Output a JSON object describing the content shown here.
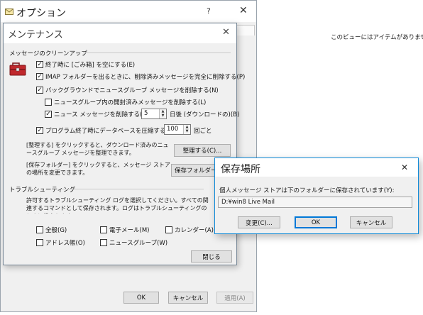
{
  "background": {
    "empty_message": "このビューにはアイテムがありません。"
  },
  "options": {
    "title": "オプション",
    "help": "?",
    "close": "✕",
    "ok_label": "OK",
    "cancel_label": "キャンセル",
    "apply_label": "適用(A)"
  },
  "maintenance": {
    "title": "メンテナンス",
    "close": "✕",
    "cleanup_group": "メッセージのクリーンアップ",
    "options": [
      {
        "label": "終了時に [ごみ箱] を空にする(E)",
        "checked": true
      },
      {
        "label": "IMAP フォルダーを出るときに、削除済みメッセージを完全に削除する(P)",
        "checked": true
      },
      {
        "label": "バックグラウンドでニュースグループ メッセージを削除する(N)",
        "checked": true
      },
      {
        "label": "ニュースグループ内の開封済みメッセージを削除する(L)",
        "checked": false
      },
      {
        "label": "ニュース メッセージを削除する(D)",
        "checked": true
      },
      {
        "label": "プログラム終了時にデータベースを圧縮する(S)",
        "checked": true
      }
    ],
    "news_days_value": "5",
    "news_days_suffix": "日後 (ダウンロードの)(B)",
    "compress_value": "100",
    "compress_suffix": "回ごと",
    "cleanup_desc": "[整理する] をクリックすると、ダウンロード済みのニュースグループ メッセージを整理できます。",
    "cleanup_button": "整理する(C)...",
    "store_desc": "[保存フォルダー] をクリックすると、メッセージ ストアの場所を変更できます。",
    "store_button": "保存フォルダー(F)...",
    "trouble_group": "トラブルシューティング",
    "trouble_desc": "許可するトラブルシューティング ログを選択してください。すべての関連するコマンドとして保存されます。ログはトラブルシューティングのときに役立ちます。",
    "logs": [
      {
        "label": "全般(G)"
      },
      {
        "label": "電子メール(M)"
      },
      {
        "label": "カレンダー(A)"
      },
      {
        "label": "アドレス帳(O)"
      },
      {
        "label": "ニュースグループ(W)"
      }
    ],
    "close_button": "閉じる"
  },
  "save_location": {
    "title": "保存場所",
    "close": "✕",
    "description": "個人メッセージ ストアは下のフォルダーに保存されています(Y):",
    "path": "D:¥win8 Live Mail",
    "change_button": "変更(C)...",
    "ok_button": "OK",
    "cancel_button": "キャンセル"
  },
  "colors": {
    "accent": "#0078d7",
    "toolbox_red": "#c0282d"
  }
}
